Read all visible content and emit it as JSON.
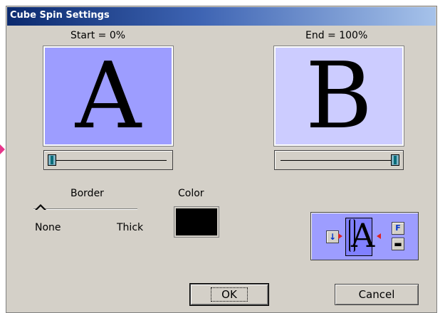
{
  "window": {
    "title": "Cube Spin Settings"
  },
  "start": {
    "label": "Start = 0%",
    "letter": "A",
    "slider_value": 0
  },
  "end": {
    "label": "End = 100%",
    "letter": "B",
    "slider_value": 100
  },
  "border": {
    "label": "Border",
    "min_label": "None",
    "max_label": "Thick",
    "value": 0
  },
  "color": {
    "label": "Color",
    "value": "#000000"
  },
  "cube_widget": {
    "letter": "A",
    "top_button": "F"
  },
  "buttons": {
    "ok": "OK",
    "cancel": "Cancel"
  },
  "colors": {
    "start_preview": "#9d9dff",
    "end_preview": "#ccccff",
    "dialog_bg": "#d4d0c8",
    "accent_arrow": "#e6358a"
  }
}
